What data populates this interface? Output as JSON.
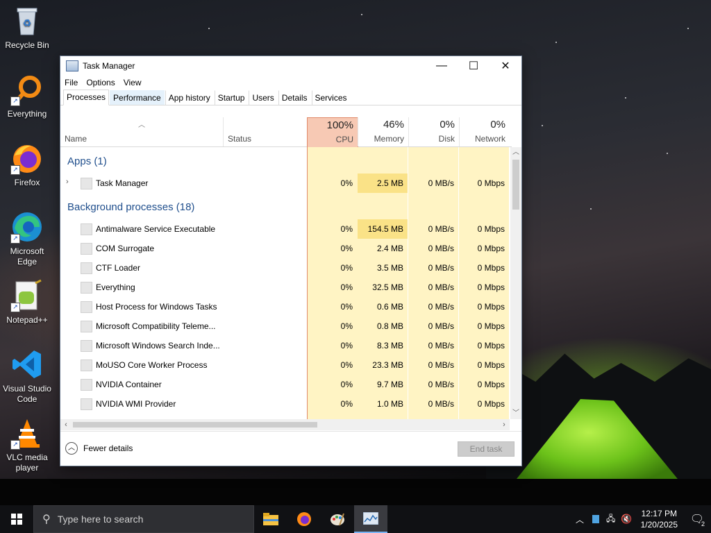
{
  "desktop": {
    "icons": [
      {
        "label": "Recycle Bin",
        "icon": "recycle-bin-icon"
      },
      {
        "label": "Everything",
        "icon": "everything-search-icon"
      },
      {
        "label": "Firefox",
        "icon": "firefox-icon"
      },
      {
        "label": "Microsoft Edge",
        "icon": "edge-icon"
      },
      {
        "label": "Notepad++",
        "icon": "notepadpp-icon"
      },
      {
        "label": "Visual Studio Code",
        "icon": "vscode-icon"
      },
      {
        "label": "VLC media player",
        "icon": "vlc-icon"
      }
    ]
  },
  "window": {
    "title": "Task Manager",
    "menu": [
      "File",
      "Options",
      "View"
    ],
    "tabs": [
      "Processes",
      "Performance",
      "App history",
      "Startup",
      "Users",
      "Details",
      "Services"
    ],
    "active_tab": "Processes",
    "columns": {
      "name": "Name",
      "status": "Status",
      "cpu": {
        "pct": "100%",
        "label": "CPU"
      },
      "memory": {
        "pct": "46%",
        "label": "Memory"
      },
      "disk": {
        "pct": "0%",
        "label": "Disk"
      },
      "network": {
        "pct": "0%",
        "label": "Network"
      }
    },
    "groups": {
      "apps": "Apps (1)",
      "background": "Background processes (18)"
    },
    "apps": [
      {
        "name": "Task Manager",
        "cpu": "0%",
        "memory": "2.5 MB",
        "disk": "0 MB/s",
        "network": "0 Mbps"
      }
    ],
    "background": [
      {
        "name": "Antimalware Service Executable",
        "cpu": "0%",
        "memory": "154.5 MB",
        "disk": "0 MB/s",
        "network": "0 Mbps"
      },
      {
        "name": "COM Surrogate",
        "cpu": "0%",
        "memory": "2.4 MB",
        "disk": "0 MB/s",
        "network": "0 Mbps"
      },
      {
        "name": "CTF Loader",
        "cpu": "0%",
        "memory": "3.5 MB",
        "disk": "0 MB/s",
        "network": "0 Mbps"
      },
      {
        "name": "Everything",
        "cpu": "0%",
        "memory": "32.5 MB",
        "disk": "0 MB/s",
        "network": "0 Mbps"
      },
      {
        "name": "Host Process for Windows Tasks",
        "cpu": "0%",
        "memory": "0.6 MB",
        "disk": "0 MB/s",
        "network": "0 Mbps"
      },
      {
        "name": "Microsoft Compatibility Teleme...",
        "cpu": "0%",
        "memory": "0.8 MB",
        "disk": "0 MB/s",
        "network": "0 Mbps"
      },
      {
        "name": "Microsoft Windows Search Inde...",
        "cpu": "0%",
        "memory": "8.3 MB",
        "disk": "0 MB/s",
        "network": "0 Mbps"
      },
      {
        "name": "MoUSO Core Worker Process",
        "cpu": "0%",
        "memory": "23.3 MB",
        "disk": "0 MB/s",
        "network": "0 Mbps"
      },
      {
        "name": "NVIDIA Container",
        "cpu": "0%",
        "memory": "9.7 MB",
        "disk": "0 MB/s",
        "network": "0 Mbps"
      },
      {
        "name": "NVIDIA WMI Provider",
        "cpu": "0%",
        "memory": "1.0 MB",
        "disk": "0 MB/s",
        "network": "0 Mbps"
      }
    ],
    "footer": {
      "fewer_details": "Fewer details",
      "end_task": "End task"
    }
  },
  "taskbar": {
    "search_placeholder": "Type here to search",
    "clock_time": "12:17 PM",
    "clock_date": "1/20/2025",
    "notification_count": "2"
  }
}
